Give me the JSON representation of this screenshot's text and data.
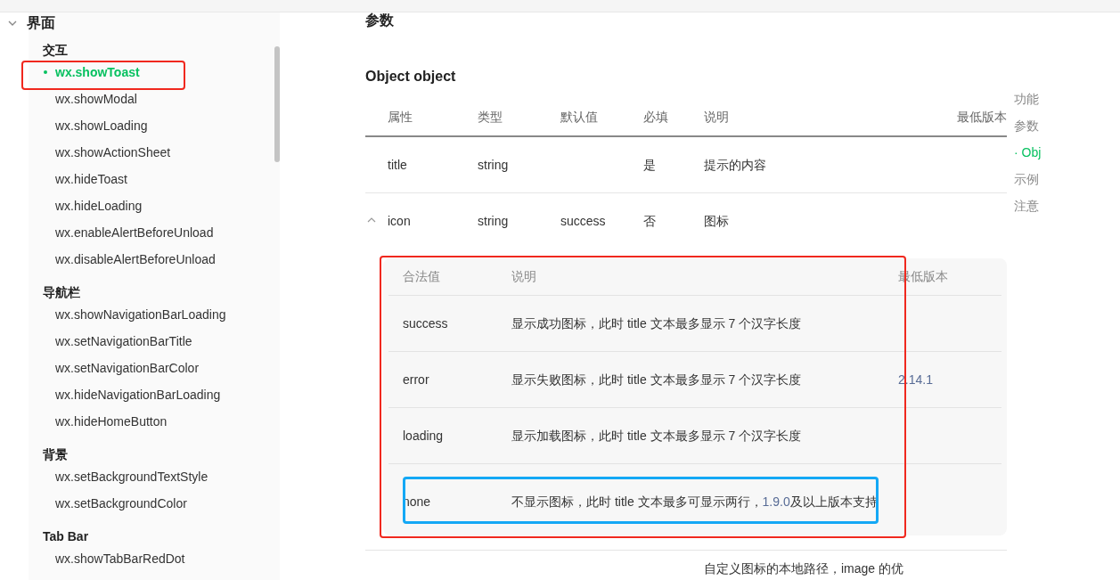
{
  "sidebar": {
    "section": {
      "title": "界面",
      "expanded": true
    },
    "groups": [
      {
        "title": "交互",
        "items": [
          {
            "label": "wx.showToast",
            "selected": true
          },
          {
            "label": "wx.showModal",
            "selected": false
          },
          {
            "label": "wx.showLoading",
            "selected": false
          },
          {
            "label": "wx.showActionSheet",
            "selected": false
          },
          {
            "label": "wx.hideToast",
            "selected": false
          },
          {
            "label": "wx.hideLoading",
            "selected": false
          },
          {
            "label": "wx.enableAlertBeforeUnload",
            "selected": false
          },
          {
            "label": "wx.disableAlertBeforeUnload",
            "selected": false
          }
        ]
      },
      {
        "title": "导航栏",
        "items": [
          {
            "label": "wx.showNavigationBarLoading",
            "selected": false
          },
          {
            "label": "wx.setNavigationBarTitle",
            "selected": false
          },
          {
            "label": "wx.setNavigationBarColor",
            "selected": false
          },
          {
            "label": "wx.hideNavigationBarLoading",
            "selected": false
          },
          {
            "label": "wx.hideHomeButton",
            "selected": false
          }
        ]
      },
      {
        "title": "背景",
        "items": [
          {
            "label": "wx.setBackgroundTextStyle",
            "selected": false
          },
          {
            "label": "wx.setBackgroundColor",
            "selected": false
          }
        ]
      },
      {
        "title": "Tab Bar",
        "items": [
          {
            "label": "wx.showTabBarRedDot",
            "selected": false
          }
        ]
      }
    ]
  },
  "main": {
    "heading": "参数",
    "subheading": "Object object",
    "table": {
      "columns": [
        "属性",
        "类型",
        "默认值",
        "必填",
        "说明",
        "最低版本"
      ],
      "rows": [
        {
          "kind": "plain",
          "cells": [
            "title",
            "string",
            "",
            "是",
            "提示的内容",
            ""
          ]
        },
        {
          "kind": "expandable",
          "expanded": true,
          "cells": [
            "icon",
            "string",
            "success",
            "否",
            "图标",
            ""
          ]
        }
      ]
    },
    "subtable": {
      "columns": [
        "合法值",
        "说明",
        "最低版本"
      ],
      "rows": [
        {
          "value": "success",
          "description": [
            {
              "kind": "text",
              "text": "显示成功图标，此时 title 文本最多显示 7 个汉字长度"
            }
          ],
          "version": ""
        },
        {
          "value": "error",
          "description": [
            {
              "kind": "text",
              "text": "显示失败图标，此时 title 文本最多显示 7 个汉字长度"
            }
          ],
          "version": "2.14.1"
        },
        {
          "value": "loading",
          "description": [
            {
              "kind": "text",
              "text": "显示加载图标，此时 title 文本最多显示 7 个汉字长度"
            }
          ],
          "version": ""
        },
        {
          "value": "none",
          "description": [
            {
              "kind": "text",
              "text": "不显示图标，此时 title 文本最多可显示两行，"
            },
            {
              "kind": "link",
              "text": "1.9.0"
            },
            {
              "kind": "text",
              "text": "及以上版本支持"
            }
          ],
          "version": ""
        }
      ]
    },
    "next_row_text": "自定义图标的本地路径，image 的优"
  },
  "toc": [
    {
      "label": "功能",
      "selected": false
    },
    {
      "label": "参数",
      "selected": false
    },
    {
      "label": "· Obj",
      "selected": true
    },
    {
      "label": "示例",
      "selected": false
    },
    {
      "label": "注意",
      "selected": false
    }
  ]
}
